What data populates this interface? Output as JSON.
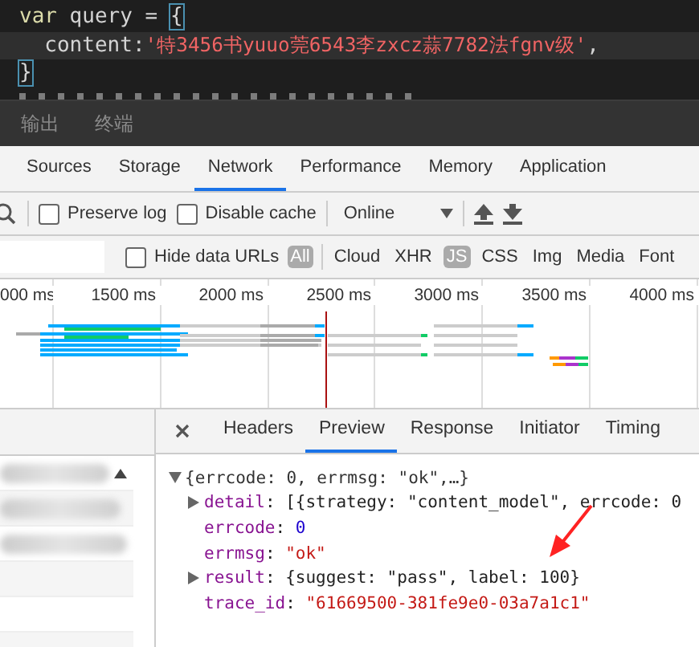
{
  "editor": {
    "lines": [
      {
        "highlighted": false,
        "tokens": [
          {
            "kind": "keyword",
            "text": "var"
          },
          {
            "kind": "plain",
            "text": " query = "
          },
          {
            "kind": "brace",
            "text": "{"
          }
        ]
      },
      {
        "highlighted": true,
        "tokens": [
          {
            "kind": "plain",
            "text": "  content:"
          },
          {
            "kind": "string",
            "text": "'特3456书yuuo莞6543李zxcz蒜7782法fgnv级'"
          },
          {
            "kind": "plain",
            "text": ","
          }
        ]
      },
      {
        "highlighted": false,
        "tokens": [
          {
            "kind": "brace",
            "text": "}"
          }
        ]
      }
    ]
  },
  "panel_tabs": [
    {
      "label": "输出"
    },
    {
      "label": "终端"
    }
  ],
  "devtools": {
    "tabs": [
      {
        "label": "Sources",
        "selected": false
      },
      {
        "label": "Storage",
        "selected": false
      },
      {
        "label": "Network",
        "selected": true
      },
      {
        "label": "Performance",
        "selected": false
      },
      {
        "label": "Memory",
        "selected": false
      },
      {
        "label": "Application",
        "selected": false
      }
    ],
    "toolbar": {
      "preserve_log": {
        "label": "Preserve log",
        "checked": false
      },
      "disable_cache": {
        "label": "Disable cache",
        "checked": false
      },
      "throttle": "Online"
    },
    "filter": {
      "hide_data_urls": {
        "label": "Hide data URLs",
        "checked": false
      },
      "types": [
        {
          "label": "All",
          "selected": true
        },
        {
          "label": "Cloud",
          "selected": false
        },
        {
          "label": "XHR",
          "selected": false
        },
        {
          "label": "JS",
          "selected": true
        },
        {
          "label": "CSS",
          "selected": false
        },
        {
          "label": "Img",
          "selected": false
        },
        {
          "label": "Media",
          "selected": false
        },
        {
          "label": "Font"
        }
      ]
    },
    "timeline_ticks": [
      "000 ms",
      "1500 ms",
      "2000 ms",
      "2500 ms",
      "3000 ms",
      "3500 ms",
      "4000 ms"
    ],
    "detail_tabs": [
      {
        "label": "Headers",
        "selected": false
      },
      {
        "label": "Preview",
        "selected": true
      },
      {
        "label": "Response",
        "selected": false
      },
      {
        "label": "Initiator",
        "selected": false
      },
      {
        "label": "Timing",
        "selected": false
      }
    ],
    "preview": {
      "summary": "{errcode: 0, errmsg: \"ok\",…}",
      "expanded": true,
      "children": [
        {
          "kind": "object",
          "tokens": [
            {
              "kind": "key",
              "text": "detail"
            },
            {
              "kind": "punct",
              "text": ": [{strategy: \"content_model\", errcode: 0"
            }
          ]
        },
        {
          "kind": "value",
          "tokens": [
            {
              "kind": "key",
              "text": "errcode"
            },
            {
              "kind": "punct",
              "text": ": "
            },
            {
              "kind": "number",
              "text": "0"
            }
          ]
        },
        {
          "kind": "value",
          "tokens": [
            {
              "kind": "key",
              "text": "errmsg"
            },
            {
              "kind": "punct",
              "text": ": "
            },
            {
              "kind": "string",
              "text": "\"ok\""
            }
          ]
        },
        {
          "kind": "object",
          "tokens": [
            {
              "kind": "key",
              "text": "result"
            },
            {
              "kind": "punct",
              "text": ": {suggest: \"pass\", label: 100}"
            }
          ]
        },
        {
          "kind": "value",
          "tokens": [
            {
              "kind": "key",
              "text": "trace_id"
            },
            {
              "kind": "punct",
              "text": ": "
            },
            {
              "kind": "string",
              "text": "\"61669500-381fe9e0-03a7a1c1\""
            }
          ]
        }
      ]
    }
  }
}
